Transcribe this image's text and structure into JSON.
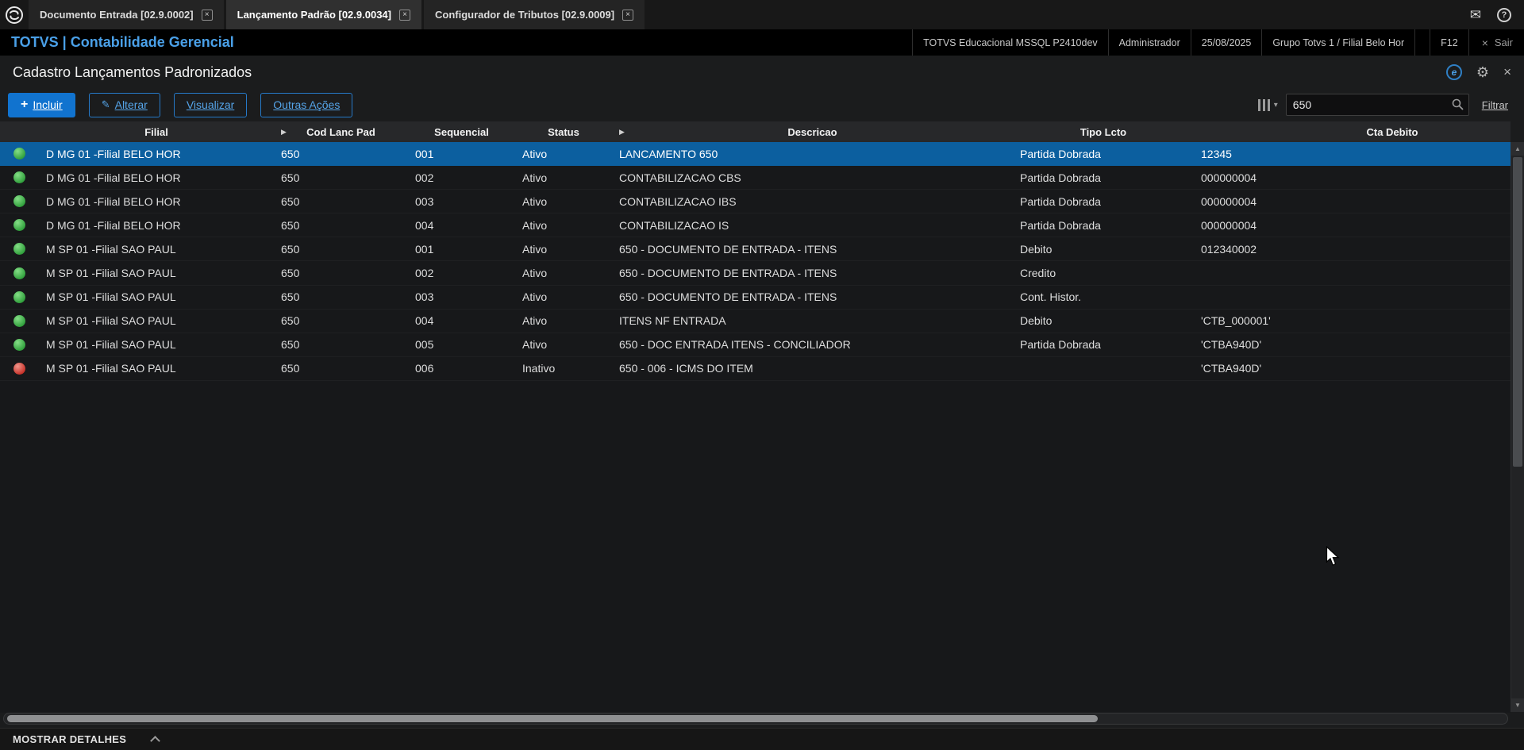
{
  "topbar": {
    "tabs": [
      {
        "label": "Documento Entrada [02.9.0002]"
      },
      {
        "label": "Lançamento Padrão [02.9.0034]"
      },
      {
        "label": "Configurador de Tributos [02.9.0009]"
      }
    ],
    "icons": {
      "tab_close": "×",
      "mail": "✉",
      "help": "?"
    }
  },
  "header": {
    "app_title": "TOTVS | Contabilidade Gerencial",
    "environment": "TOTVS Educacional MSSQL P2410dev",
    "user": "Administrador",
    "date": "25/08/2025",
    "branch": "Grupo Totvs 1 / Filial Belo Hor",
    "f12": "F12",
    "exit_icon": "×",
    "exit_label": "Sair"
  },
  "page": {
    "title": "Cadastro Lançamentos Padronizados",
    "icons": {
      "e_badge": "e",
      "gear": "⚙",
      "close": "×"
    }
  },
  "toolbar": {
    "buttons": {
      "incluir": "Incluir",
      "alterar": "Alterar",
      "visualizar": "Visualizar",
      "outras_acoes": "Outras Ações"
    },
    "icons": {
      "plus": "+",
      "pencil": "✎",
      "caret": "▾"
    },
    "search": {
      "value": "650"
    },
    "filtrar": "Filtrar"
  },
  "table": {
    "columns": [
      {
        "label": "Filial"
      },
      {
        "label": "Cod Lanc Pad",
        "arrow": "▶"
      },
      {
        "label": "Sequencial"
      },
      {
        "label": "Status"
      },
      {
        "label": "Descricao",
        "arrow": "▶"
      },
      {
        "label": "Tipo Lcto"
      },
      {
        "label": "Cta Debito"
      }
    ],
    "rows": [
      {
        "dot": "green",
        "filial": "D MG 01 -Filial BELO HOR",
        "cod": "650",
        "seq": "001",
        "status": "Ativo",
        "descricao": "LANCAMENTO 650",
        "tipo": "Partida Dobrada",
        "cta": "12345",
        "selected": true
      },
      {
        "dot": "green",
        "filial": "D MG 01 -Filial BELO HOR",
        "cod": "650",
        "seq": "002",
        "status": "Ativo",
        "descricao": "CONTABILIZACAO CBS",
        "tipo": "Partida Dobrada",
        "cta": "000000004"
      },
      {
        "dot": "green",
        "filial": "D MG 01 -Filial BELO HOR",
        "cod": "650",
        "seq": "003",
        "status": "Ativo",
        "descricao": "CONTABILIZACAO IBS",
        "tipo": "Partida Dobrada",
        "cta": "000000004"
      },
      {
        "dot": "green",
        "filial": "D MG 01 -Filial BELO HOR",
        "cod": "650",
        "seq": "004",
        "status": "Ativo",
        "descricao": "CONTABILIZACAO IS",
        "tipo": "Partida Dobrada",
        "cta": "000000004"
      },
      {
        "dot": "green",
        "filial": "M SP 01 -Filial SAO PAUL",
        "cod": "650",
        "seq": "001",
        "status": "Ativo",
        "descricao": "650 - DOCUMENTO DE ENTRADA - ITENS",
        "tipo": "Debito",
        "cta": "012340002"
      },
      {
        "dot": "green",
        "filial": "M SP 01 -Filial SAO PAUL",
        "cod": "650",
        "seq": "002",
        "status": "Ativo",
        "descricao": "650 - DOCUMENTO DE ENTRADA - ITENS",
        "tipo": "Credito",
        "cta": ""
      },
      {
        "dot": "green",
        "filial": "M SP 01 -Filial SAO PAUL",
        "cod": "650",
        "seq": "003",
        "status": "Ativo",
        "descricao": "650 - DOCUMENTO DE ENTRADA - ITENS",
        "tipo": "Cont. Histor.",
        "cta": ""
      },
      {
        "dot": "green",
        "filial": "M SP 01 -Filial SAO PAUL",
        "cod": "650",
        "seq": "004",
        "status": "Ativo",
        "descricao": "ITENS NF ENTRADA",
        "tipo": "Debito",
        "cta": "'CTB_000001'"
      },
      {
        "dot": "green",
        "filial": "M SP 01 -Filial SAO PAUL",
        "cod": "650",
        "seq": "005",
        "status": "Ativo",
        "descricao": "650 - DOC ENTRADA ITENS - CONCILIADOR",
        "tipo": "Partida Dobrada",
        "cta": "'CTBA940D'"
      },
      {
        "dot": "red",
        "filial": "M SP 01 -Filial SAO PAUL",
        "cod": "650",
        "seq": "006",
        "status": "Inativo",
        "descricao": "650 - 006 - ICMS DO ITEM",
        "tipo": "",
        "cta": "'CTBA940D'"
      }
    ]
  },
  "footer": {
    "label": "MOSTRAR DETALHES"
  }
}
